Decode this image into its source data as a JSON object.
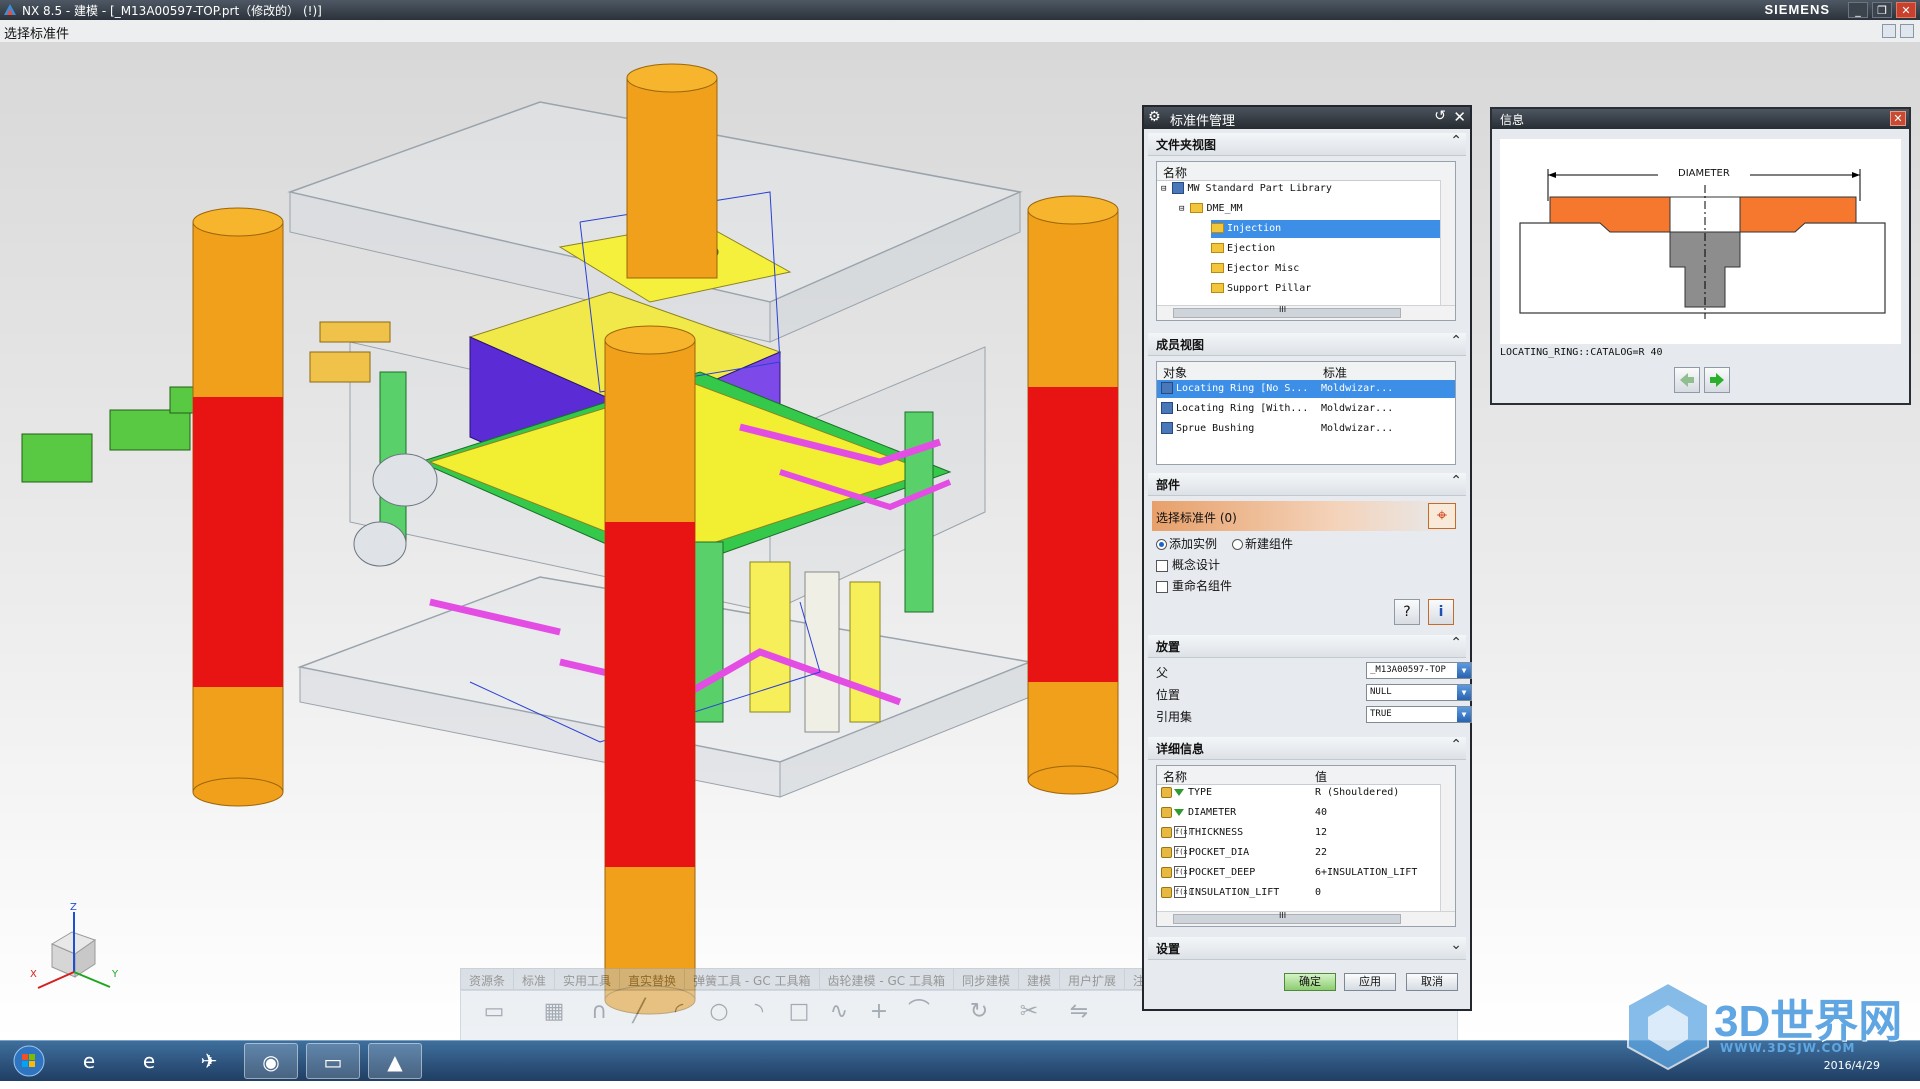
{
  "window": {
    "title": "NX 8.5 - 建模 - [_M13A00597-TOP.prt（修改的）  (!)]",
    "brand": "SIEMENS",
    "min": "_",
    "restore": "❐",
    "close": "✕"
  },
  "cue_line": "选择标准件",
  "dialog": {
    "title": "标准件管理",
    "sections": {
      "folder_view": "文件夹视图",
      "member_view": "成员视图",
      "part": "部件",
      "placement": "放置",
      "details": "详细信息",
      "settings": "设置"
    },
    "folder_tree": {
      "header": "名称",
      "items": [
        {
          "label": "MW Standard Part Library",
          "level": 0,
          "selected": false
        },
        {
          "label": "DME_MM",
          "level": 1,
          "selected": false
        },
        {
          "label": "Injection",
          "level": 2,
          "selected": true
        },
        {
          "label": "Ejection",
          "level": 2,
          "selected": false
        },
        {
          "label": "Ejector Misc",
          "level": 2,
          "selected": false
        },
        {
          "label": "Support Pillar",
          "level": 2,
          "selected": false
        }
      ],
      "hscroll_grip": "III"
    },
    "member_table": {
      "headers": [
        "对象",
        "标准"
      ],
      "rows": [
        {
          "object": "Locating Ring [No S...",
          "standard": "Moldwizar...",
          "selected": true
        },
        {
          "object": "Locating Ring [With...",
          "standard": "Moldwizar...",
          "selected": false
        },
        {
          "object": "Sprue Bushing",
          "standard": "Moldwizar...",
          "selected": false
        }
      ]
    },
    "part": {
      "select_label": "选择标准件 (0)",
      "add_instance": "添加实例",
      "new_component": "新建组件",
      "concept_design": "概念设计",
      "rename_component": "重命名组件",
      "add_instance_checked": true
    },
    "placement": {
      "parent_label": "父",
      "parent_value": "_M13A00597-TOP",
      "position_label": "位置",
      "position_value": "NULL",
      "refset_label": "引用集",
      "refset_value": "TRUE"
    },
    "details": {
      "headers": [
        "名称",
        "值"
      ],
      "rows": [
        {
          "name": "TYPE",
          "value": "R (Shouldered)",
          "icon": "tri"
        },
        {
          "name": "DIAMETER",
          "value": "40",
          "icon": "tri"
        },
        {
          "name": "THICKNESS",
          "value": "12",
          "icon": "fx"
        },
        {
          "name": "POCKET_DIA",
          "value": "22",
          "icon": "fx"
        },
        {
          "name": "POCKET_DEEP",
          "value": "6+INSULATION_LIFT",
          "icon": "fx"
        },
        {
          "name": "INSULATION_LIFT",
          "value": "0",
          "icon": "fx"
        }
      ],
      "hscroll_grip": "III"
    },
    "buttons": {
      "ok": "确定",
      "apply": "应用",
      "cancel": "取消"
    }
  },
  "info_window": {
    "title": "信息",
    "dimension_label": "DIAMETER",
    "catalog": "LOCATING_RING::CATALOG=R 40"
  },
  "toolbar_tabs": [
    "资源条",
    "标准",
    "实用工具",
    "直实替换",
    "弹簧工具 - GC 工具箱",
    "齿轮建模 - GC 工具箱",
    "同步建模",
    "建模",
    "用户扩展",
    "注塑"
  ],
  "axis_labels": {
    "z": "Z",
    "x": "X",
    "y": "Y"
  },
  "taskbar": {
    "date": "2016/4/29"
  },
  "watermark": {
    "text": "3D世界网",
    "url": "WWW.3DSJW.COM"
  },
  "colors": {
    "selection": "#3c8ee6",
    "pillar_orange": "#f0a01a",
    "pillar_red": "#e81414",
    "accent_orange": "#d2441b"
  }
}
